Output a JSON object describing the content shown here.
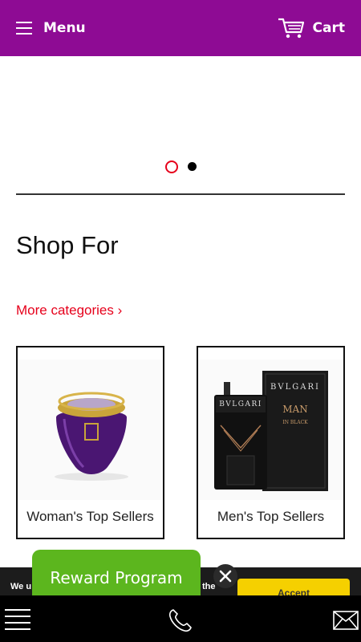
{
  "header": {
    "menu_label": "Menu",
    "cart_label": "Cart",
    "background": "#8e0b94"
  },
  "carousel": {
    "slide_count": 2,
    "active_index": 0
  },
  "section": {
    "title": "Shop For",
    "more_link": "More categories ›"
  },
  "cards": [
    {
      "label": "Woman's Top Sellers"
    },
    {
      "label": "Men's Top Sellers"
    }
  ],
  "product_box": {
    "brand": "BVLGARI",
    "line1": "MAN",
    "line2": "IN BLACK"
  },
  "cookie": {
    "text_start": "We u",
    "text_end": "the",
    "accept_label": "Accept"
  },
  "reward": {
    "label": "Reward Program",
    "color": "#5cb61e"
  },
  "bottom_bar": {
    "icons": [
      "menu-icon",
      "phone-icon",
      "mail-icon"
    ]
  }
}
